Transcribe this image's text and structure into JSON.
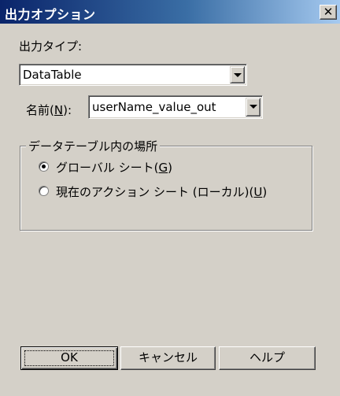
{
  "window": {
    "title": "出力オプション",
    "close_label": "✕"
  },
  "output_type": {
    "label": "出力タイプ:",
    "value": "DataTable"
  },
  "name_field": {
    "label_prefix": "名前(",
    "label_key": "N",
    "label_suffix": "):",
    "value": "userName_value_out"
  },
  "location_group": {
    "caption": "データテーブル内の場所",
    "options": [
      {
        "prefix": "グローバル シート(",
        "key": "G",
        "suffix": ")",
        "checked": true
      },
      {
        "prefix": "現在のアクション シート (ローカル)(",
        "key": "U",
        "suffix": ")",
        "checked": false
      }
    ]
  },
  "buttons": {
    "ok": "OK",
    "cancel": "キャンセル",
    "help": "ヘルプ"
  }
}
